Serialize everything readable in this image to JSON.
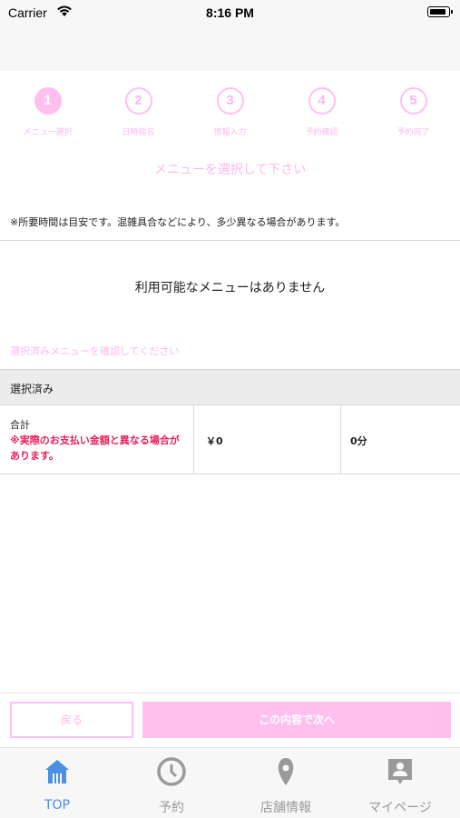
{
  "status_bar": {
    "carrier": "Carrier",
    "time": "8:16 PM"
  },
  "steps": [
    {
      "number": "1",
      "label": "メニュー選択",
      "active": true
    },
    {
      "number": "2",
      "label": "日時指名",
      "active": false
    },
    {
      "number": "3",
      "label": "情報入力",
      "active": false
    },
    {
      "number": "4",
      "label": "予約確認",
      "active": false
    },
    {
      "number": "5",
      "label": "予約完了",
      "active": false
    }
  ],
  "main": {
    "heading": "メニューを選択して下さい",
    "note": "※所要時間は目安です。混雑具合などにより、多少異なる場合があります。",
    "empty_message": "利用可能なメニューはありません",
    "confirm_label": "選択済みメニューを確認してください"
  },
  "selected": {
    "header": "選択済み",
    "total_label": "合計",
    "total_note": "※実際のお支払い金額と異なる場合があります。",
    "price": "￥0",
    "duration": "0分"
  },
  "buttons": {
    "back": "戻る",
    "next": "この内容で次へ"
  },
  "tab_bar": [
    {
      "label": "TOP",
      "icon": "home-icon",
      "active": true
    },
    {
      "label": "予約",
      "icon": "clock-icon",
      "active": false
    },
    {
      "label": "店舗情報",
      "icon": "map-pin-icon",
      "active": false
    },
    {
      "label": "マイページ",
      "icon": "profile-icon",
      "active": false
    }
  ],
  "colors": {
    "accent_pink": "#ffc0f0",
    "text_pink": "#ffb8ee",
    "warning_red": "#e8205c",
    "tab_active": "#4a8fe0",
    "tab_inactive": "#9a9a9a"
  }
}
